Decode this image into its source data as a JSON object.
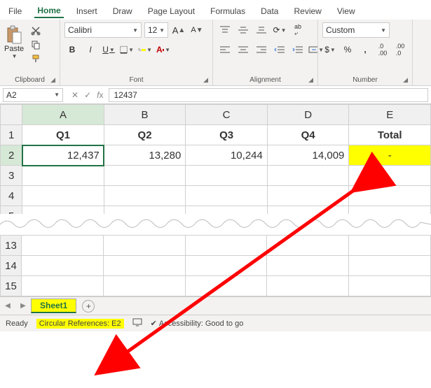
{
  "tabs": [
    "File",
    "Home",
    "Insert",
    "Draw",
    "Page Layout",
    "Formulas",
    "Data",
    "Review",
    "View"
  ],
  "active_tab": "Home",
  "clipboard": {
    "paste": "Paste",
    "label": "Clipboard"
  },
  "font": {
    "name": "Calibri",
    "size": "12",
    "label": "Font",
    "fill_color": "#ffff00",
    "font_color": "#c00000"
  },
  "alignment": {
    "label": "Alignment",
    "wrap": "ab",
    "merge": "Merge"
  },
  "number": {
    "format": "Custom",
    "label": "Number"
  },
  "namebox": "A2",
  "formula": "12437",
  "columns": [
    "A",
    "B",
    "C",
    "D",
    "E"
  ],
  "rows_top": [
    "1",
    "2",
    "3",
    "4",
    "5"
  ],
  "rows_bottom": [
    "13",
    "14",
    "15"
  ],
  "headers": [
    "Q1",
    "Q2",
    "Q3",
    "Q4",
    "Total"
  ],
  "values": [
    "12,437",
    "13,280",
    "10,244",
    "14,009",
    "-"
  ],
  "active_cell": "A2",
  "sheet_tab": "Sheet1",
  "status": {
    "ready": "Ready",
    "circular": "Circular References: E2",
    "accessibility": "Accessibility: Good to go"
  }
}
